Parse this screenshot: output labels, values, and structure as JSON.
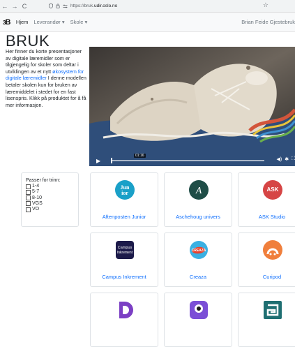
{
  "browser": {
    "back": "←",
    "forward": "→",
    "reload": "C",
    "url_prefix": "https://bruk.",
    "url_domain": "udir.oslo.no",
    "bookmark": "☆"
  },
  "navbar": {
    "brand": "B",
    "items": [
      "Hjem",
      "Leverandør ▾",
      "Skole ▾"
    ],
    "user": "Brian Feide Gjestebruk"
  },
  "page": {
    "title": "BRUK",
    "intro_1": "Her finner du korte presentasjoner av digitale læremidler som er tilgjengelig for skoler som deltar i utviklingen av et nytt ",
    "intro_link": "økosystem for digitale læremidler",
    "intro_2": " I denne modellen betaler skolen kun for bruken av læremiddelet i stedet for en fast lisenspris. Klikk på produktet for å få mer informasjon."
  },
  "video": {
    "timestamp": "01:16",
    "progress": 0.0
  },
  "filter": {
    "title": "Passer for trinn:",
    "options": [
      "1-4",
      "5-7",
      "8-10",
      "VGS",
      "VO"
    ]
  },
  "products": [
    {
      "name": "Aftenposten Junior",
      "logo_text": "Jun ior",
      "color": "#1aa0c8"
    },
    {
      "name": "Aschehoug univers",
      "logo_text": "A",
      "color": "#1f4d47"
    },
    {
      "name": "ASK Studio",
      "logo_text": "ASK",
      "color": "#d64545"
    },
    {
      "name": "Campus Inkrement",
      "logo_text": "Campus Inkrement",
      "color": "#1c1a4a"
    },
    {
      "name": "Creaza",
      "logo_text": "CREAZA",
      "color": "#e8412c"
    },
    {
      "name": "Curipod",
      "logo_text": "",
      "color": "#f07f3c"
    },
    {
      "name": "",
      "logo_text": "",
      "color": "#7b3fc4"
    },
    {
      "name": "",
      "logo_text": "",
      "color": "#7b4fd6"
    },
    {
      "name": "",
      "logo_text": "",
      "color": "#1f6f72"
    }
  ]
}
